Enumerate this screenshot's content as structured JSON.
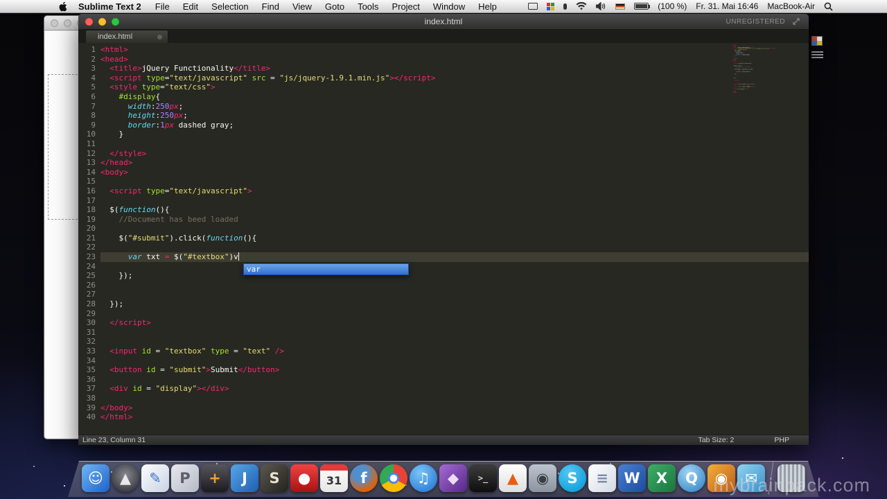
{
  "menubar": {
    "app_name": "Sublime Text 2",
    "menus": [
      "File",
      "Edit",
      "Selection",
      "Find",
      "View",
      "Goto",
      "Tools",
      "Project",
      "Window",
      "Help"
    ],
    "status": {
      "battery_label": "(100 %)",
      "clock": "Fr. 31. Mai 16:46",
      "device_name": "MacBook-Air"
    }
  },
  "window": {
    "title": "index.html",
    "registration": "UNREGISTERED",
    "tab": {
      "label": "index.html"
    },
    "statusbar": {
      "left": "Line 23, Column 31",
      "tab_size": "Tab Size: 2",
      "syntax": "PHP"
    },
    "autocomplete": {
      "selected": "var"
    }
  },
  "editor": {
    "current_line": 23,
    "cursor": {
      "line": 23,
      "column": 31
    },
    "colors": {
      "background": "#272822",
      "tag": "#f92672",
      "attribute": "#a6e22e",
      "string": "#e6db74",
      "keyword": "#66d9ef",
      "number": "#ae81ff",
      "comment": "#75715e",
      "text": "#f8f8f2",
      "line_highlight": "#3e3d32",
      "gutter": "#8f908a"
    },
    "lines": [
      [
        {
          "t": "<html>",
          "c": "tag"
        }
      ],
      [
        {
          "t": "<head>",
          "c": "tag"
        }
      ],
      [
        {
          "t": "  ",
          "c": "pln"
        },
        {
          "t": "<title>",
          "c": "tag"
        },
        {
          "t": "jQuery Functionality",
          "c": "pln"
        },
        {
          "t": "</title>",
          "c": "tag"
        }
      ],
      [
        {
          "t": "  ",
          "c": "pln"
        },
        {
          "t": "<script ",
          "c": "tag"
        },
        {
          "t": "type",
          "c": "attr"
        },
        {
          "t": "=",
          "c": "pln"
        },
        {
          "t": "\"text/javascript\"",
          "c": "str"
        },
        {
          "t": " ",
          "c": "pln"
        },
        {
          "t": "src",
          "c": "attr"
        },
        {
          "t": " = ",
          "c": "pln"
        },
        {
          "t": "\"js/jquery-1.9.1.min.js\"",
          "c": "str"
        },
        {
          "t": "></script>",
          "c": "tag"
        }
      ],
      [
        {
          "t": "  ",
          "c": "pln"
        },
        {
          "t": "<style ",
          "c": "tag"
        },
        {
          "t": "type",
          "c": "attr"
        },
        {
          "t": "=",
          "c": "pln"
        },
        {
          "t": "\"text/css\"",
          "c": "str"
        },
        {
          "t": ">",
          "c": "tag"
        }
      ],
      [
        {
          "t": "    ",
          "c": "pln"
        },
        {
          "t": "#display",
          "c": "attr"
        },
        {
          "t": "{",
          "c": "pln"
        }
      ],
      [
        {
          "t": "      ",
          "c": "pln"
        },
        {
          "t": "width",
          "c": "kw"
        },
        {
          "t": ":",
          "c": "pln"
        },
        {
          "t": "250",
          "c": "num"
        },
        {
          "t": "px",
          "c": "unit"
        },
        {
          "t": ";",
          "c": "pln"
        }
      ],
      [
        {
          "t": "      ",
          "c": "pln"
        },
        {
          "t": "height",
          "c": "kw"
        },
        {
          "t": ":",
          "c": "pln"
        },
        {
          "t": "250",
          "c": "num"
        },
        {
          "t": "px",
          "c": "unit"
        },
        {
          "t": ";",
          "c": "pln"
        }
      ],
      [
        {
          "t": "      ",
          "c": "pln"
        },
        {
          "t": "border",
          "c": "kw"
        },
        {
          "t": ":",
          "c": "pln"
        },
        {
          "t": "1",
          "c": "num"
        },
        {
          "t": "px",
          "c": "unit"
        },
        {
          "t": " dashed gray;",
          "c": "pln"
        }
      ],
      [
        {
          "t": "    }",
          "c": "pln"
        }
      ],
      [],
      [
        {
          "t": "  ",
          "c": "pln"
        },
        {
          "t": "</style>",
          "c": "tag"
        }
      ],
      [
        {
          "t": "</head>",
          "c": "tag"
        }
      ],
      [
        {
          "t": "<body>",
          "c": "tag"
        }
      ],
      [],
      [
        {
          "t": "  ",
          "c": "pln"
        },
        {
          "t": "<script ",
          "c": "tag"
        },
        {
          "t": "type",
          "c": "attr"
        },
        {
          "t": "=",
          "c": "pln"
        },
        {
          "t": "\"text/javascript\"",
          "c": "str"
        },
        {
          "t": ">",
          "c": "tag"
        }
      ],
      [],
      [
        {
          "t": "  $(",
          "c": "pln"
        },
        {
          "t": "function",
          "c": "kw"
        },
        {
          "t": "(){",
          "c": "pln"
        }
      ],
      [
        {
          "t": "    ",
          "c": "pln"
        },
        {
          "t": "//Document has beed loaded",
          "c": "cmt"
        }
      ],
      [],
      [
        {
          "t": "    $(",
          "c": "pln"
        },
        {
          "t": "\"#submit\"",
          "c": "str"
        },
        {
          "t": ").click(",
          "c": "pln"
        },
        {
          "t": "function",
          "c": "kw"
        },
        {
          "t": "(){",
          "c": "pln"
        }
      ],
      [],
      [
        {
          "t": "      ",
          "c": "pln"
        },
        {
          "t": "var",
          "c": "kw"
        },
        {
          "t": " txt ",
          "c": "pln"
        },
        {
          "t": "=",
          "c": "op"
        },
        {
          "t": " $(",
          "c": "pln"
        },
        {
          "t": "\"#textbox\"",
          "c": "str"
        },
        {
          "t": ")v",
          "c": "pln"
        }
      ],
      [],
      [
        {
          "t": "    });",
          "c": "pln"
        }
      ],
      [],
      [],
      [
        {
          "t": "  });",
          "c": "pln"
        }
      ],
      [],
      [
        {
          "t": "  ",
          "c": "pln"
        },
        {
          "t": "</script>",
          "c": "tag"
        }
      ],
      [],
      [],
      [
        {
          "t": "  ",
          "c": "pln"
        },
        {
          "t": "<input ",
          "c": "tag"
        },
        {
          "t": "id",
          "c": "attr"
        },
        {
          "t": " = ",
          "c": "pln"
        },
        {
          "t": "\"textbox\"",
          "c": "str"
        },
        {
          "t": " ",
          "c": "pln"
        },
        {
          "t": "type",
          "c": "attr"
        },
        {
          "t": " = ",
          "c": "pln"
        },
        {
          "t": "\"text\"",
          "c": "str"
        },
        {
          "t": " />",
          "c": "tag"
        }
      ],
      [],
      [
        {
          "t": "  ",
          "c": "pln"
        },
        {
          "t": "<button ",
          "c": "tag"
        },
        {
          "t": "id",
          "c": "attr"
        },
        {
          "t": " = ",
          "c": "pln"
        },
        {
          "t": "\"submit\"",
          "c": "str"
        },
        {
          "t": ">",
          "c": "tag"
        },
        {
          "t": "Submit",
          "c": "pln"
        },
        {
          "t": "</button>",
          "c": "tag"
        }
      ],
      [],
      [
        {
          "t": "  ",
          "c": "pln"
        },
        {
          "t": "<div ",
          "c": "tag"
        },
        {
          "t": "id",
          "c": "attr"
        },
        {
          "t": " = ",
          "c": "pln"
        },
        {
          "t": "\"display\"",
          "c": "str"
        },
        {
          "t": "></div>",
          "c": "tag"
        }
      ],
      [],
      [
        {
          "t": "</body>",
          "c": "tag"
        }
      ],
      [
        {
          "t": "</html>",
          "c": "tag"
        }
      ]
    ]
  },
  "dock": {
    "apps": [
      {
        "name": "finder",
        "glyph": "☺",
        "bg": "linear-gradient(135deg,#6fb5f5,#1e62c8)",
        "fg": "#ffffff"
      },
      {
        "name": "launchpad",
        "glyph": "▲",
        "bg": "radial-gradient(circle at 50% 40%,#8a8a92,#222228)",
        "fg": "#e8e8e8",
        "cls": "round"
      },
      {
        "name": "pen-app",
        "glyph": "✎",
        "bg": "linear-gradient(135deg,#fdfdfd,#c9d2e4)",
        "fg": "#3d72c0"
      },
      {
        "name": "preview-app",
        "glyph": "P",
        "bg": "linear-gradient(135deg,#e9e9ee,#b4bac6)",
        "fg": "#5a5f6b"
      },
      {
        "name": "calculator",
        "glyph": "+",
        "bg": "linear-gradient(180deg,#55555b,#1c1c20)",
        "fg": "#f0a030"
      },
      {
        "name": "j-app",
        "glyph": "J",
        "bg": "linear-gradient(135deg,#58a6e8,#1d5fb0)",
        "fg": "#ffffff"
      },
      {
        "name": "sublime-text",
        "glyph": "S",
        "bg": "linear-gradient(135deg,#5a584f,#23221d)",
        "fg": "#e8e3d0"
      },
      {
        "name": "red-app",
        "glyph": "●",
        "bg": "linear-gradient(180deg,#f04343,#a81212)",
        "fg": "#ffffff"
      },
      {
        "name": "calendar",
        "glyph": "31",
        "bg": "linear-gradient(180deg,#ffffff,#e6e6e6)",
        "fg": "#333333",
        "cls": "calendar"
      },
      {
        "name": "firefox",
        "glyph": "f",
        "bg": "radial-gradient(circle at 38% 32%,#4f8fd0 28%,#e66000 72%)",
        "fg": "#ffffff",
        "cls": "round"
      },
      {
        "name": "chrome",
        "glyph": "",
        "bg": "conic-gradient(#ea4335 0 120deg,#fbbc05 120deg 240deg,#34a853 240deg 360deg)",
        "fg": "#ffffff",
        "cls": "round chrome"
      },
      {
        "name": "itunes",
        "glyph": "♫",
        "bg": "radial-gradient(circle at 38% 30%,#7cc4f7,#1b6fd0)",
        "fg": "#ffffff",
        "cls": "round"
      },
      {
        "name": "purple-app",
        "glyph": "◆",
        "bg": "linear-gradient(135deg,#a66bd4,#55278a)",
        "fg": "#ecdcf8"
      },
      {
        "name": "terminal",
        "glyph": ">_",
        "bg": "linear-gradient(180deg,#3d3d3d,#0e0e0e)",
        "fg": "#d8d8d8",
        "cls": "terminal"
      },
      {
        "name": "vlc",
        "glyph": "▲",
        "bg": "linear-gradient(180deg,#ffffff,#dedede)",
        "fg": "#e85d10"
      },
      {
        "name": "github",
        "glyph": "◉",
        "bg": "linear-gradient(180deg,#bcc5cf,#8a939e)",
        "fg": "#393e44"
      },
      {
        "name": "skype",
        "glyph": "S",
        "bg": "radial-gradient(circle at 38% 30%,#56c6f2,#0096d6)",
        "fg": "#ffffff",
        "cls": "round"
      },
      {
        "name": "document-app",
        "glyph": "≡",
        "bg": "linear-gradient(135deg,#ffffff,#d3d9e4)",
        "fg": "#7a8aa8"
      },
      {
        "name": "word",
        "glyph": "W",
        "bg": "linear-gradient(135deg,#4a7fd4,#1c4c9c)",
        "fg": "#ffffff"
      },
      {
        "name": "excel",
        "glyph": "X",
        "bg": "linear-gradient(135deg,#3fae68,#19753d)",
        "fg": "#ffffff"
      },
      {
        "name": "quicktime",
        "glyph": "Q",
        "bg": "radial-gradient(circle at 38% 30%,#9fd4f5,#2a7fc0)",
        "fg": "#ffffff",
        "cls": "round"
      },
      {
        "name": "photo-booth",
        "glyph": "◉",
        "bg": "linear-gradient(135deg,#f2b03c,#bd5c18)",
        "fg": "#ffffff"
      },
      {
        "name": "mail-app",
        "glyph": "✉",
        "bg": "linear-gradient(135deg,#8fd4f0,#3a8fc8)",
        "fg": "#ffffff"
      },
      {
        "name": "trash",
        "glyph": "",
        "bg": "repeating-linear-gradient(90deg,#d2d7dd 0 3px,#989fa8 3px 6px)",
        "fg": "#555555"
      }
    ]
  },
  "watermark": "mybrainpack.com"
}
